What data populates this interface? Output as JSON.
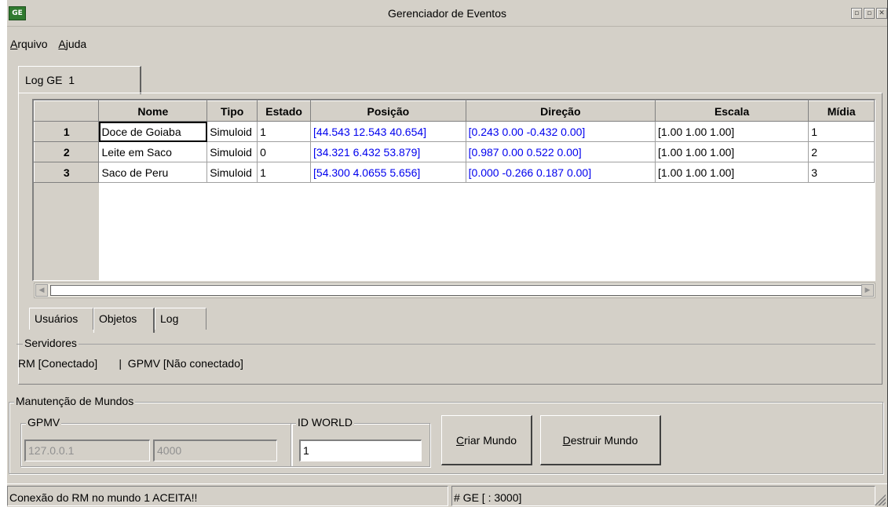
{
  "window": {
    "icon_text": "GE",
    "title": "Gerenciador de Eventos",
    "minimize": "▫",
    "maximize": "▫",
    "close": "✕"
  },
  "menu": {
    "items": [
      {
        "label_first": "A",
        "label_rest": "rquivo"
      },
      {
        "label_first": "A",
        "label_rest": "juda"
      }
    ]
  },
  "top_tab": {
    "label": "Log GE  1"
  },
  "grid": {
    "columns": [
      "",
      "Nome",
      "Tipo",
      "Estado",
      "Posição",
      "Direção",
      "Escala",
      "Mídia"
    ],
    "rows": [
      {
        "num": "1",
        "nome": "Doce de Goiaba",
        "tipo": "Simuloid",
        "estado": "1",
        "posicao": "[44.543  12.543  40.654]",
        "direcao": "[0.243  0.00  -0.432  0.00]",
        "escala": "[1.00  1.00  1.00]",
        "midia": "1"
      },
      {
        "num": "2",
        "nome": "Leite em Saco",
        "tipo": "Simuloid",
        "estado": "0",
        "posicao": "[34.321  6.432  53.879]",
        "direcao": "[0.987  0.00  0.522  0.00]",
        "escala": "[1.00  1.00  1.00]",
        "midia": "2"
      },
      {
        "num": "3",
        "nome": "Saco de Peru",
        "tipo": "Simuloid",
        "estado": "1",
        "posicao": "[54.300  4.0655  5.656]",
        "direcao": "[0.000  -0.266  0.187  0.00]",
        "escala": "[1.00  1.00  1.00]",
        "midia": "3"
      }
    ]
  },
  "bottom_tabs": [
    "Usuários",
    "Objetos",
    "Log"
  ],
  "servidores": {
    "label": "Servidores",
    "status_text": "RM [Conectado]       |  GPMV [Não conectado]"
  },
  "manutencao": {
    "label": "Manutenção de Mundos",
    "gpmv": {
      "label": "GPMV",
      "ip": "127.0.0.1",
      "port": "4000"
    },
    "id_world": {
      "label": "ID WORLD",
      "value": "1"
    },
    "criar": {
      "first": "C",
      "rest": "riar Mundo"
    },
    "destruir": {
      "first": "D",
      "rest": "estruir Mundo"
    }
  },
  "status": {
    "message": "Conexão do RM no mundo 1 ACEITA!!",
    "port_info": "# GE [ : 3000]"
  }
}
